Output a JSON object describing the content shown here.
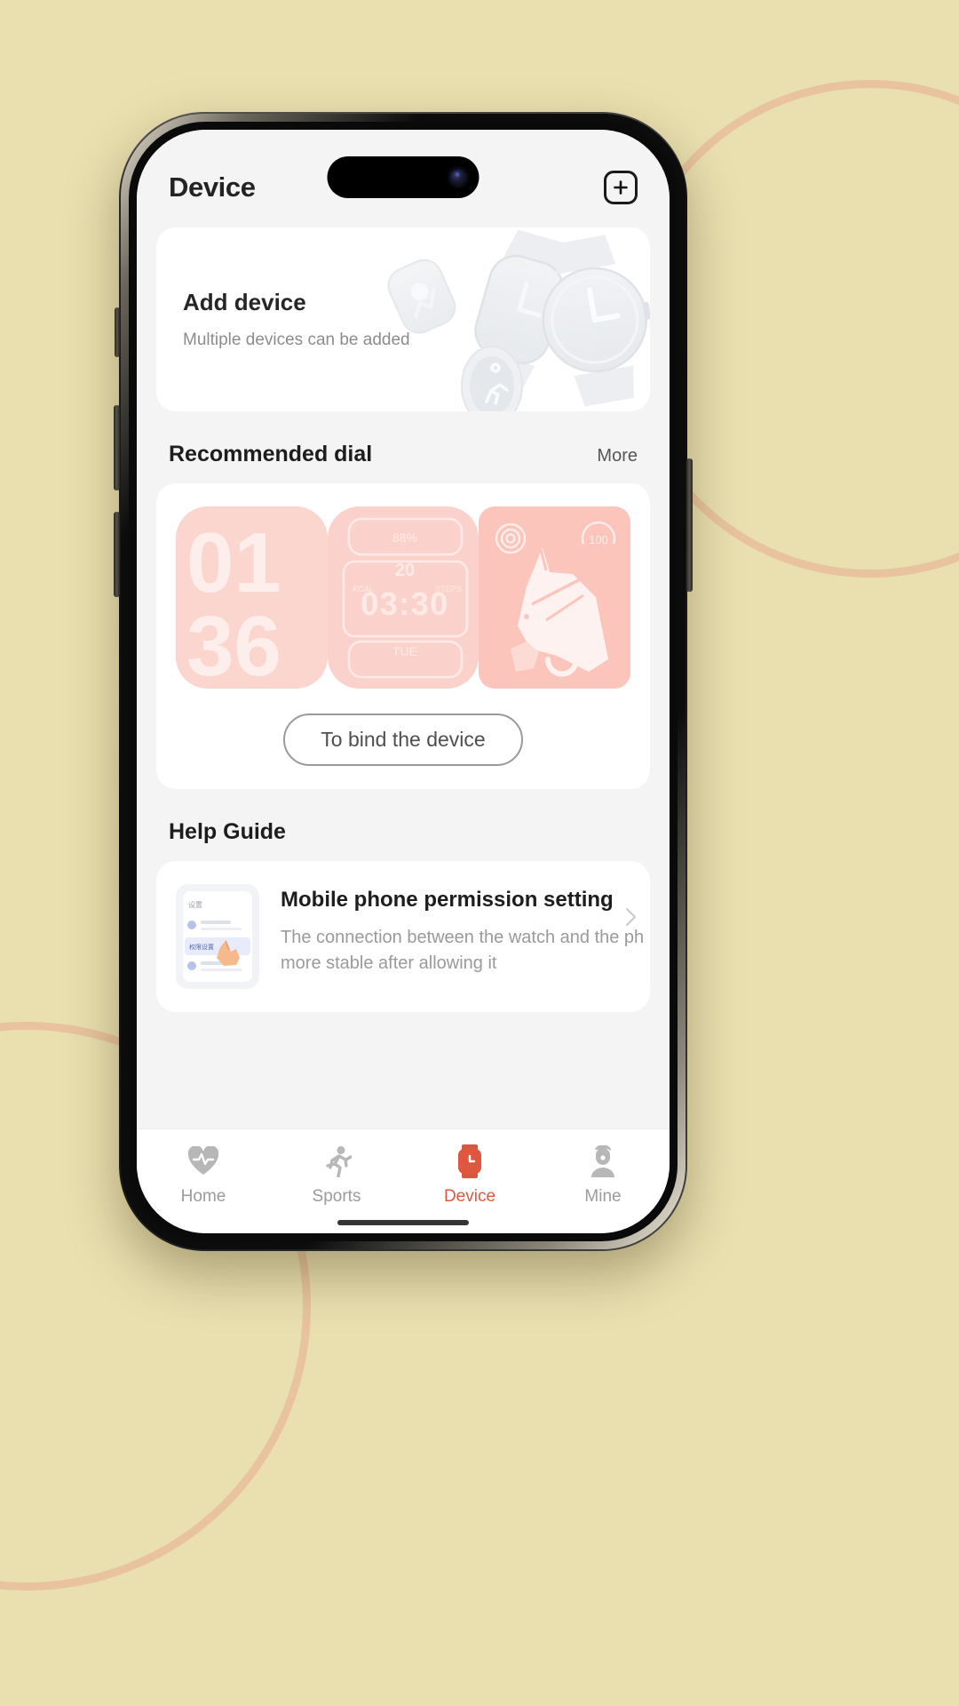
{
  "background": {
    "color": "#e9dfaf",
    "ring_color": "#e79683"
  },
  "header": {
    "title": "Device",
    "add_button_icon": "plus-icon"
  },
  "add_device_card": {
    "title": "Add device",
    "subtitle": "Multiple devices can be added"
  },
  "recommended_dial": {
    "section_title": "Recommended dial",
    "more_label": "More",
    "bind_button_label": "To bind the device",
    "dials": [
      {
        "name": "big-numerals-dial",
        "hour": "01",
        "minute": "36"
      },
      {
        "name": "digital-grid-dial",
        "time": "03:30",
        "date_num": "20",
        "weekday": "TUE",
        "battery": "88%",
        "left_label": "KCAL",
        "right_label": "STEPS"
      },
      {
        "name": "horse-dial",
        "gauge": "100"
      }
    ]
  },
  "help_guide": {
    "section_title": "Help Guide",
    "items": [
      {
        "title": "Mobile phone permission setting",
        "description_line1": "The connection between the watch and the ph",
        "description_line2": "more stable after allowing it",
        "thumb_label": "设置",
        "thumb_row_label": "权限设置"
      }
    ]
  },
  "tabbar": {
    "active_color": "#e0573f",
    "inactive_color": "#9b9b9b",
    "tabs": [
      {
        "label": "Home",
        "icon": "heart-pulse-icon",
        "active": false
      },
      {
        "label": "Sports",
        "icon": "runner-icon",
        "active": false
      },
      {
        "label": "Device",
        "icon": "watch-icon",
        "active": true
      },
      {
        "label": "Mine",
        "icon": "person-icon",
        "active": false
      }
    ]
  }
}
